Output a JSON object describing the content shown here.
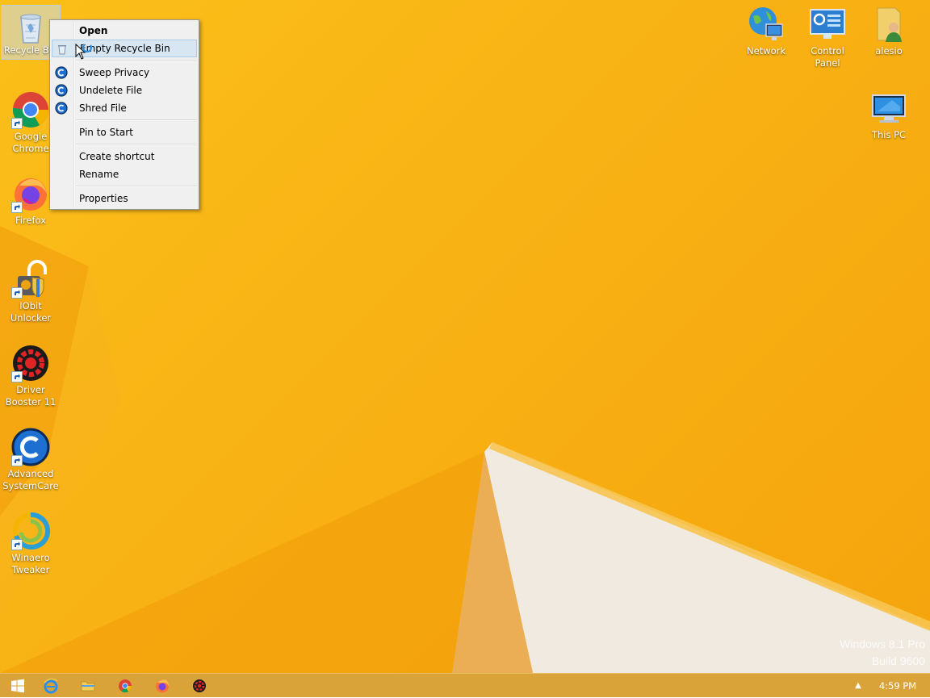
{
  "desktop_icons_left": [
    {
      "id": "recycle-bin",
      "label": "Recycle Bin"
    },
    {
      "id": "google-chrome",
      "label": "Google Chrome"
    },
    {
      "id": "firefox",
      "label": "Firefox"
    },
    {
      "id": "iobit-unlocker",
      "label": "IObit Unlocker"
    },
    {
      "id": "driver-booster",
      "label": "Driver Booster 11"
    },
    {
      "id": "advanced-systemcare",
      "label": "Advanced SystemCare"
    },
    {
      "id": "winaero-tweaker",
      "label": "Winaero Tweaker"
    }
  ],
  "desktop_icons_right": [
    {
      "id": "network",
      "label": "Network"
    },
    {
      "id": "control-panel",
      "label": "Control Panel"
    },
    {
      "id": "alesio",
      "label": "alesio"
    },
    {
      "id": "this-pc",
      "label": "This PC"
    }
  ],
  "context_menu": {
    "items": [
      {
        "label": "Open"
      },
      {
        "label": "Empty Recycle Bin"
      },
      {
        "label": "Sweep Privacy"
      },
      {
        "label": "Undelete File"
      },
      {
        "label": "Shred File"
      },
      {
        "label": "Pin to Start"
      },
      {
        "label": "Create shortcut"
      },
      {
        "label": "Rename"
      },
      {
        "label": "Properties"
      }
    ]
  },
  "watermark": {
    "line1": "Windows 8.1 Pro",
    "line2": "Build 9600"
  },
  "taskbar": {
    "clock": "4:59 PM",
    "tray_chevron": "▲"
  },
  "colors": {
    "wallpaper": "#f8b214",
    "menu_hover": "#d8e6f2",
    "asc_blue": "#1d6fd1"
  }
}
